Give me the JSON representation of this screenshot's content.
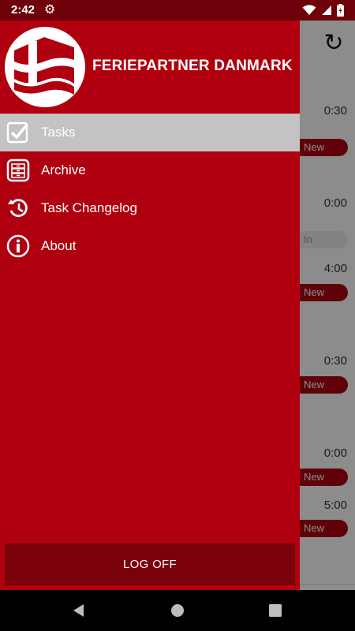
{
  "status_bar": {
    "time": "2:42"
  },
  "background_list": {
    "rows": [
      {
        "time": "0:30",
        "badge": "New",
        "badge_type": "new"
      },
      {
        "time": "0:00",
        "badge": "In progress",
        "badge_type": "progress"
      },
      {
        "time": "4:00",
        "badge": "New",
        "badge_type": "new"
      },
      {
        "time": "0:30",
        "badge": "New",
        "badge_type": "new"
      },
      {
        "time": "0:00",
        "badge": "New",
        "badge_type": "new"
      },
      {
        "time": "5:00",
        "badge": "New",
        "badge_type": "new"
      }
    ]
  },
  "drawer": {
    "brand": "FERIEPARTNER DANMARK",
    "items": [
      {
        "label": "Tasks",
        "icon": "checkbox-icon",
        "selected": true
      },
      {
        "label": "Archive",
        "icon": "cabinet-icon",
        "selected": false
      },
      {
        "label": "Task Changelog",
        "icon": "history-icon",
        "selected": false
      },
      {
        "label": "About",
        "icon": "info-icon",
        "selected": false
      }
    ],
    "logoff_label": "LOG OFF"
  },
  "colors": {
    "drawer_red": "#b0000f",
    "status_dark_red": "#6e0009",
    "logoff_dark_red": "#7a0009",
    "selected_gray": "#c3c3c3"
  }
}
